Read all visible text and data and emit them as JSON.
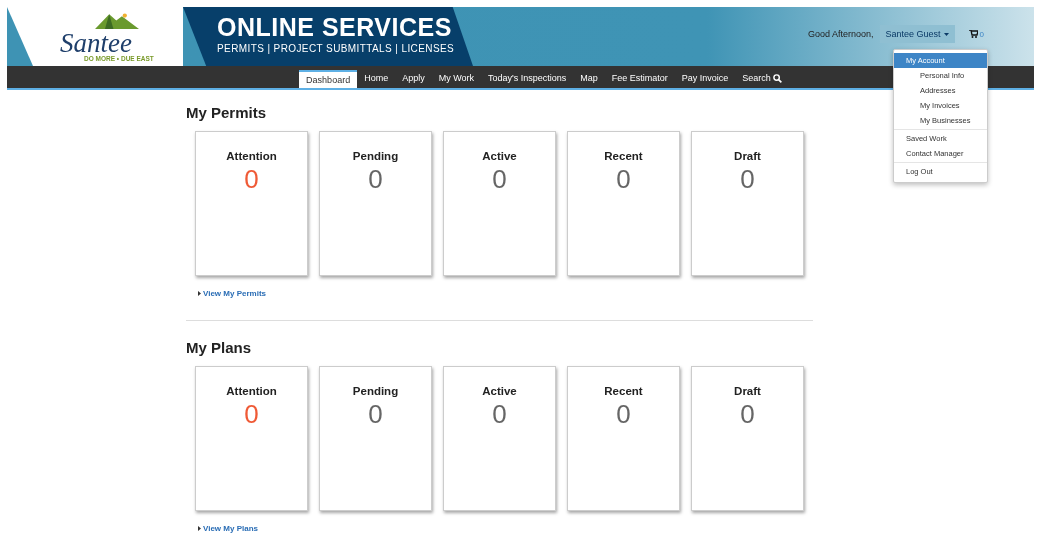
{
  "header": {
    "logo": {
      "name": "Santee",
      "tagline": "DO MORE • DUE EAST"
    },
    "title": "ONLINE SERVICES",
    "subtitle": "PERMITS | PROJECT SUBMITTALS | LICENSES",
    "greeting": "Good Afternoon,",
    "user": "Santee Guest",
    "cart_count": "0"
  },
  "nav": [
    {
      "label": "Dashboard",
      "selected": true
    },
    {
      "label": "Home",
      "selected": false
    },
    {
      "label": "Apply",
      "selected": false
    },
    {
      "label": "My Work",
      "selected": false
    },
    {
      "label": "Today's Inspections",
      "selected": false
    },
    {
      "label": "Map",
      "selected": false
    },
    {
      "label": "Fee Estimator",
      "selected": false
    },
    {
      "label": "Pay Invoice",
      "selected": false
    },
    {
      "label": "Search",
      "selected": false,
      "kind": "search"
    }
  ],
  "account_menu": [
    {
      "items": [
        {
          "label": "My Account",
          "selected": true,
          "children": [
            {
              "label": "Personal Info",
              "selected": false
            },
            {
              "label": "Addresses",
              "selected": false
            },
            {
              "label": "My Invoices",
              "selected": false
            },
            {
              "label": "My Businesses",
              "selected": false
            }
          ]
        }
      ]
    },
    {
      "items": [
        {
          "label": "Saved Work",
          "selected": false
        },
        {
          "label": "Contact Manager",
          "selected": false
        }
      ]
    },
    {
      "items": [
        {
          "label": "Log Out",
          "selected": false
        }
      ]
    }
  ],
  "sections": [
    {
      "title": "My Permits",
      "cards": [
        {
          "label": "Attention",
          "count": "0",
          "alert": true
        },
        {
          "label": "Pending",
          "count": "0",
          "alert": false
        },
        {
          "label": "Active",
          "count": "0",
          "alert": false
        },
        {
          "label": "Recent",
          "count": "0",
          "alert": false
        },
        {
          "label": "Draft",
          "count": "0",
          "alert": false
        }
      ],
      "link": "View My Permits"
    },
    {
      "title": "My Plans",
      "cards": [
        {
          "label": "Attention",
          "count": "0",
          "alert": true
        },
        {
          "label": "Pending",
          "count": "0",
          "alert": false
        },
        {
          "label": "Active",
          "count": "0",
          "alert": false
        },
        {
          "label": "Recent",
          "count": "0",
          "alert": false
        },
        {
          "label": "Draft",
          "count": "0",
          "alert": false
        }
      ],
      "link": "View My Plans"
    }
  ]
}
